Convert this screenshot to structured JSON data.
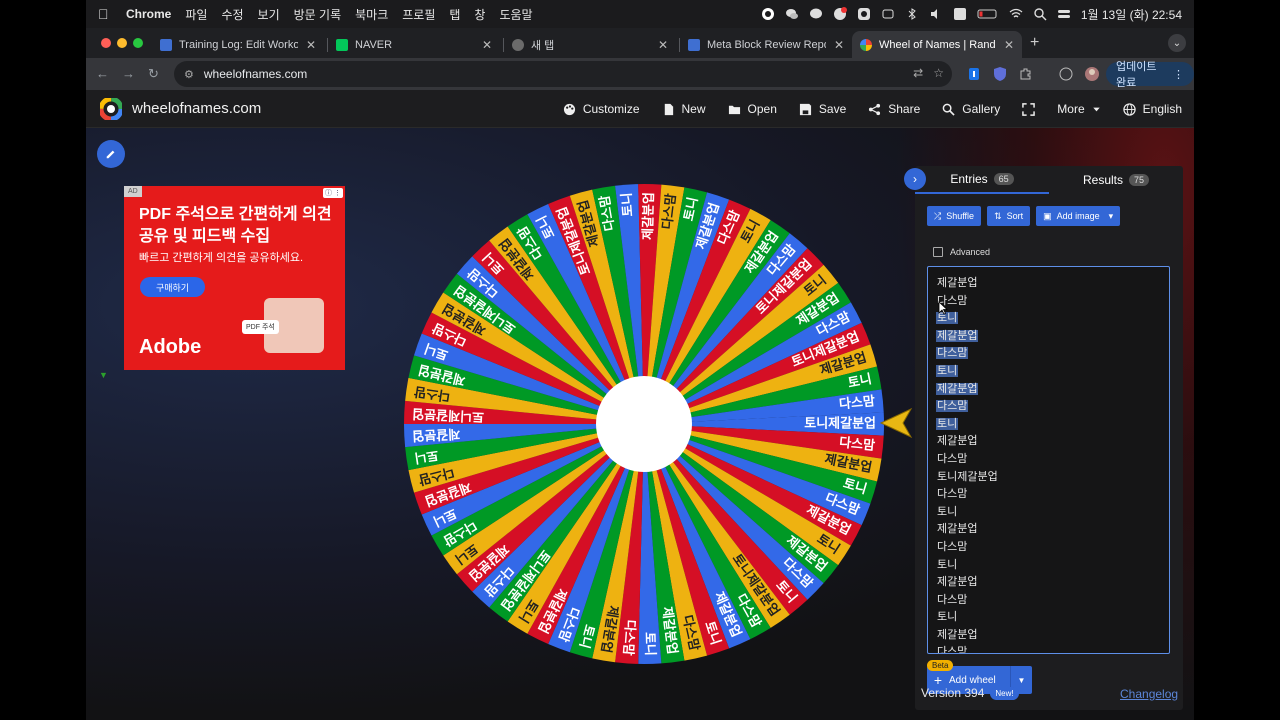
{
  "menubar": {
    "app": "Chrome",
    "items": [
      "파일",
      "수정",
      "보기",
      "방문 기록",
      "북마크",
      "프로필",
      "탭",
      "창",
      "도움말"
    ],
    "clock": "1월 13일 (화) 22:54"
  },
  "tabs": [
    {
      "label": "Training Log: Edit Workout",
      "color": "#3f6fd1"
    },
    {
      "label": "NAVER",
      "color": "#03c75a"
    },
    {
      "label": "새 탭",
      "color": "#888888"
    },
    {
      "label": "Meta Block Review Report",
      "color": "#3f6fd1"
    },
    {
      "label": "Wheel of Names | Random name",
      "color": "#ea4335"
    }
  ],
  "browser": {
    "url": "wheelofnames.com",
    "update_label": "업데이트 완료"
  },
  "app": {
    "site_name": "wheelofnames.com",
    "nav": [
      {
        "label": "Customize",
        "icon": "palette-icon"
      },
      {
        "label": "New",
        "icon": "new-file-icon"
      },
      {
        "label": "Open",
        "icon": "folder-icon"
      },
      {
        "label": "Save",
        "icon": "save-icon"
      },
      {
        "label": "Share",
        "icon": "share-icon"
      },
      {
        "label": "Gallery",
        "icon": "search-icon"
      },
      {
        "label": "",
        "icon": "fullscreen-icon"
      },
      {
        "label": "More",
        "icon": "chevron-down-icon"
      },
      {
        "label": "English",
        "icon": "globe-icon"
      }
    ]
  },
  "ad": {
    "tag": "AD",
    "headline": "PDF 주석으로 간편하게 의견 공유 및 피드백 수집",
    "sub": "빠르고 간편하게 의견을 공유하세요.",
    "cta": "구매하기",
    "badge": "PDF 주석",
    "brand": "Adobe",
    "brand_color": "#e51b1b"
  },
  "wheel": {
    "colors": [
      "#3369e8",
      "#d50f25",
      "#eeb211",
      "#009925"
    ],
    "segments": [
      "토니제갈분업",
      "다스맘",
      "제갈분업",
      "토니",
      "다스맘",
      "제갈분업",
      "토니",
      "제갈분업",
      "다스맘",
      "토니",
      "토니제갈분업",
      "다스맘",
      "제갈분업",
      "토니",
      "다스맘",
      "제갈분업",
      "토니",
      "다스맘",
      "제갈분업",
      "토니",
      "다스맘",
      "제갈분업",
      "토니",
      "토니제갈분업",
      "다스맘",
      "제갈분업",
      "토니",
      "다스맘",
      "토니",
      "제갈분업",
      "다스맘",
      "토니",
      "제갈분업",
      "토니제갈분업",
      "다스맘",
      "제갈분업",
      "토니",
      "다스맘",
      "제갈분업",
      "토니제갈분업",
      "다스맘",
      "토니",
      "제갈분업",
      "다스맘",
      "토니",
      "토니제갈분업",
      "제갈분업",
      "다스맘",
      "토니",
      "제갈분업",
      "다스맘",
      "토니",
      "제갈분업",
      "다스맘",
      "토니",
      "제갈분업",
      "다스맘",
      "토니제갈분업",
      "토니",
      "제갈분업",
      "다스맘",
      "토니제갈분업",
      "제갈분업",
      "토니",
      "다스맘"
    ]
  },
  "sidebar": {
    "entries_tab": "Entries",
    "entries_count": "65",
    "results_tab": "Results",
    "results_count": "75",
    "shuffle": "Shuffle",
    "sort": "Sort",
    "add_image": "Add image",
    "advanced": "Advanced",
    "entries": [
      {
        "text": "제갈분업",
        "selected": false
      },
      {
        "text": "다스맘",
        "selected": false
      },
      {
        "text": "토니",
        "selected": true
      },
      {
        "text": "제갈분업",
        "selected": true
      },
      {
        "text": "다스맘",
        "selected": true
      },
      {
        "text": "토니",
        "selected": true
      },
      {
        "text": "제갈분업",
        "selected": true
      },
      {
        "text": "다스맘",
        "selected": true
      },
      {
        "text": "토니",
        "selected": true
      },
      {
        "text": "제갈분업",
        "selected": false
      },
      {
        "text": "다스맘",
        "selected": false
      },
      {
        "text": "토니제갈분업",
        "selected": false
      },
      {
        "text": "다스맘",
        "selected": false
      },
      {
        "text": "토니",
        "selected": false
      },
      {
        "text": "제갈분업",
        "selected": false
      },
      {
        "text": "다스맘",
        "selected": false
      },
      {
        "text": "토니",
        "selected": false
      },
      {
        "text": "제갈분업",
        "selected": false
      },
      {
        "text": "다스맘",
        "selected": false
      },
      {
        "text": "토니",
        "selected": false
      },
      {
        "text": "제갈분업",
        "selected": false
      },
      {
        "text": "다스맘",
        "selected": false
      }
    ],
    "beta": "Beta",
    "add_wheel": "Add wheel",
    "version": "Version 394",
    "new_badge": "New!",
    "changelog": "Changelog"
  }
}
